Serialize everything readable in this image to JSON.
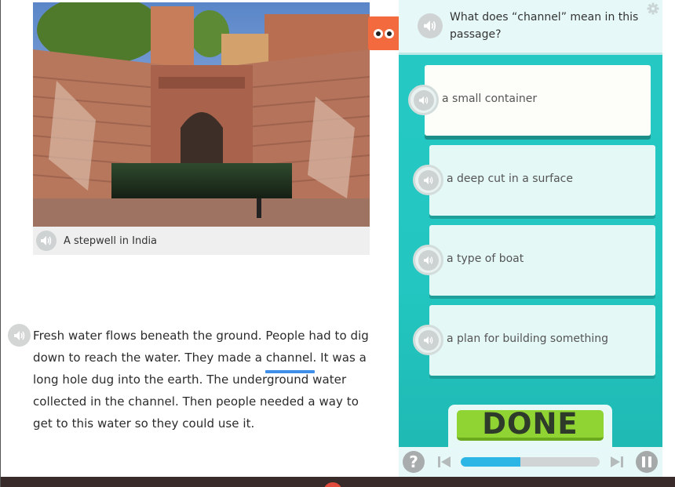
{
  "passage": {
    "image_caption": "A stepwell in India",
    "text_before": "Fresh water flows beneath the ground. People had to dig down to reach the water. They made a ",
    "vocab_word": "channel",
    "text_after": ". It was a long hole dug into the earth. The underground water collected in the channel. Then people needed a way to get to this water so they could use it."
  },
  "question": {
    "text": "What does “channel” mean in this passage?",
    "options": [
      {
        "label": "a small container"
      },
      {
        "label": "a deep cut in a surface"
      },
      {
        "label": "a type of boat"
      },
      {
        "label": "a plan for building something"
      }
    ]
  },
  "done_label": "DONE",
  "help_label": "?",
  "progress_fraction": 0.43,
  "colors": {
    "panel_teal": "#26c9c4",
    "done_green": "#8fd432",
    "progress_blue": "#2bb6e6",
    "vocab_underline": "#3f8ee8",
    "orange_tab": "#f26a3d"
  },
  "icons": [
    "speaker-icon",
    "gear-icon",
    "eyes-icon",
    "help-icon",
    "skip-back-icon",
    "skip-forward-icon",
    "pause-icon"
  ]
}
